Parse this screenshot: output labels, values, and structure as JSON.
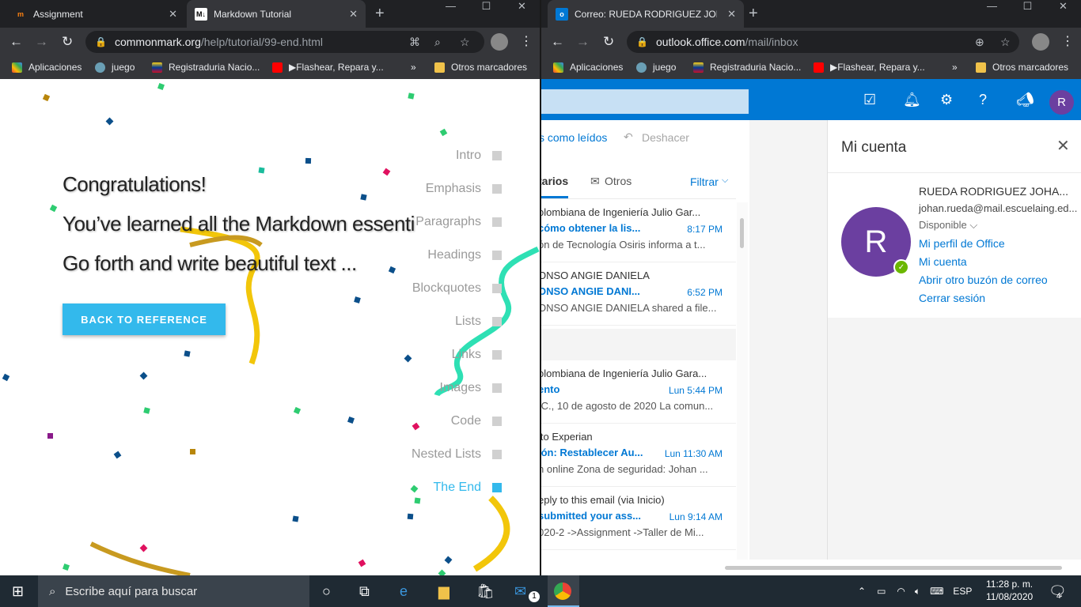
{
  "left_browser": {
    "tabs": [
      {
        "title": "Assignment",
        "icon": "moodle-icon"
      },
      {
        "title": "Markdown Tutorial",
        "icon": "markdown-icon"
      }
    ],
    "url_host": "commonmark.org",
    "url_path": "/help/tutorial/99-end.html",
    "bookmarks": [
      "Aplicaciones",
      "juego",
      "Registraduria Nacio...",
      "▶Flashear, Repara y...",
      "»",
      "Otros marcadores"
    ]
  },
  "tutorial": {
    "line1": "Congratulations!",
    "line2": "You’ve learned all the Markdown essenti",
    "line3": "Go forth and write beautiful text ...",
    "back_button": "BACK TO REFERENCE",
    "nav": [
      "Intro",
      "Emphasis",
      "Paragraphs",
      "Headings",
      "Blockquotes",
      "Lists",
      "Links",
      "Images",
      "Code",
      "Nested Lists",
      "The End"
    ],
    "current": "The End",
    "accent_color": "#33b9ec"
  },
  "right_browser": {
    "tab_title": "Correo: RUEDA RODRIGUEZ JOHA",
    "url_host": "outlook.office.com",
    "url_path": "/mail/inbox",
    "bookmarks": [
      "Aplicaciones",
      "juego",
      "Registraduria Nacio...",
      "▶Flashear, Repara y...",
      "»",
      "Otros marcadores"
    ]
  },
  "outlook": {
    "avatar_letter": "R",
    "commands": {
      "mark_read": "s como leídos",
      "undo": "Deshacer"
    },
    "tabs": {
      "focused": "tarios",
      "other": "Otros",
      "filter": "Filtrar"
    },
    "mails": [
      {
        "from": "olombiana de Ingeniería Julio Gar...",
        "subject": "cómo obtener la lis...",
        "time": "8:17 PM",
        "preview": "ón de Tecnología Osiris informa a t..."
      },
      {
        "from": "ONSO ANGIE DANIELA",
        "subject": "ONSO ANGIE DANI...",
        "time": "6:52 PM",
        "preview": "ONSO ANGIE DANIELA shared a file..."
      },
      {
        "from": "olombiana de Ingeniería Julio Gara...",
        "subject": "ento",
        "time": "Lun 5:44 PM",
        "preview": ".C., 10 de agosto de 2020 La comun..."
      },
      {
        "from": "ito Experian",
        "subject": "ión: Restablecer Au...",
        "time": "Lun 11:30 AM",
        "preview": "n online Zona de seguridad: Johan ..."
      },
      {
        "from": "eply to this email (via Inicio)",
        "subject": " submitted your ass...",
        "time": "Lun 9:14 AM",
        "preview": "020-2 ->Assignment ->Taller de Mi..."
      }
    ],
    "account": {
      "panel_title": "Mi cuenta",
      "name": "RUEDA RODRIGUEZ JOHA...",
      "email": "johan.rueda@mail.escuelaing.ed...",
      "status": "Disponible",
      "links": [
        "Mi perfil de Office",
        "Mi cuenta",
        "Abrir otro buzón de correo",
        "Cerrar sesión"
      ],
      "avatar_color": "#6b3fa0"
    }
  },
  "taskbar": {
    "search_placeholder": "Escribe aquí para buscar",
    "lang": "ESP",
    "time": "11:28 p. m.",
    "date": "11/08/2020",
    "notifications": "4",
    "mail_badge": "1"
  }
}
